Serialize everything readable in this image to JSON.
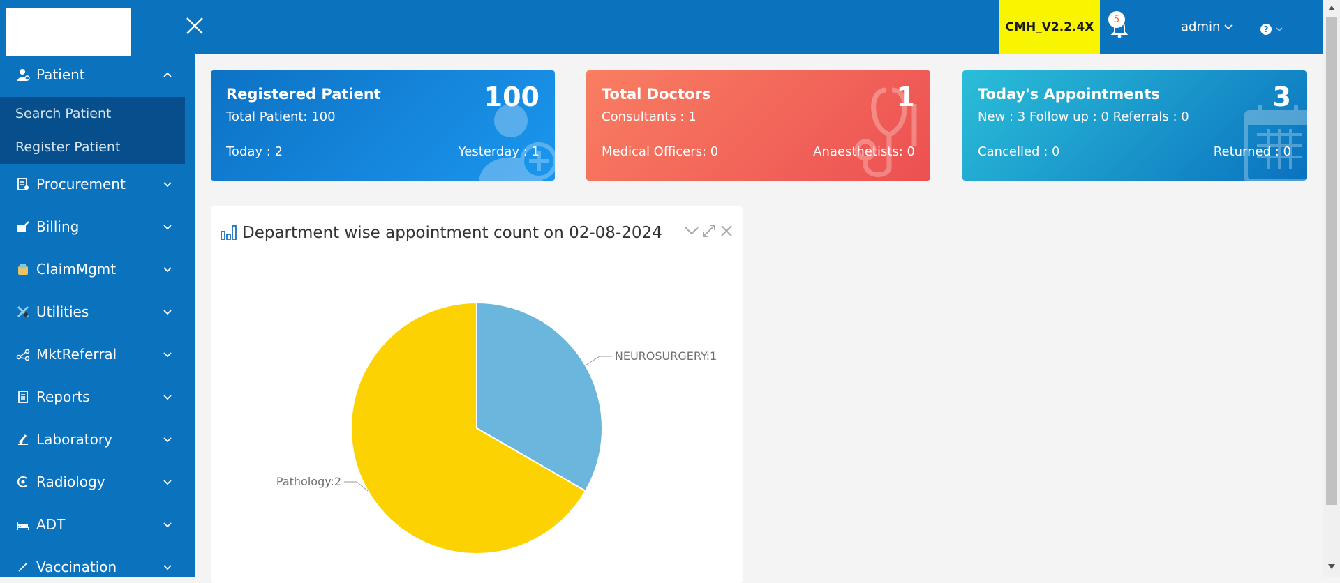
{
  "header": {
    "version": "CMH_V2.2.4X",
    "notifications_count": "5",
    "user": "admin"
  },
  "sidebar": {
    "patient": {
      "label": "Patient",
      "submenu": [
        "Search Patient",
        "Register Patient"
      ]
    },
    "items": [
      {
        "label": "Procurement",
        "icon": "procurement-icon"
      },
      {
        "label": "Billing",
        "icon": "billing-icon"
      },
      {
        "label": "ClaimMgmt",
        "icon": "claim-icon"
      },
      {
        "label": "Utilities",
        "icon": "utilities-icon"
      },
      {
        "label": "MktReferral",
        "icon": "referral-icon"
      },
      {
        "label": "Reports",
        "icon": "reports-icon"
      },
      {
        "label": "Laboratory",
        "icon": "laboratory-icon"
      },
      {
        "label": "Radiology",
        "icon": "radiology-icon"
      },
      {
        "label": "ADT",
        "icon": "adt-icon"
      },
      {
        "label": "Vaccination",
        "icon": "vaccination-icon"
      }
    ]
  },
  "cards": {
    "patients": {
      "title": "Registered Patient",
      "count": "100",
      "subtitle": "Total Patient: 100",
      "bottom_left": "Today : 2",
      "bottom_right": "Yesterday : 1",
      "color": "#1b8be0"
    },
    "doctors": {
      "title": "Total Doctors",
      "count": "1",
      "subtitle": "Consultants : 1",
      "bottom_left": "Medical Officers: 0",
      "bottom_right": "Anaesthetists: 0",
      "color": "#f0645a"
    },
    "appointments": {
      "title": "Today's Appointments",
      "count": "3",
      "subtitle": "New : 3   Follow up : 0   Referrals : 0",
      "bottom_left": "Cancelled : 0",
      "bottom_right": "Returned : 0",
      "color": "#1fa9cf"
    }
  },
  "panel": {
    "title": "Department wise appointment count on 02-08-2024"
  },
  "chart_data": {
    "type": "pie",
    "slices": [
      {
        "label": "NEUROSURGERY:1",
        "value": 1,
        "color": "#6bb6dc"
      },
      {
        "label": "Pathology:2",
        "value": 2,
        "color": "#fcd202"
      }
    ]
  }
}
